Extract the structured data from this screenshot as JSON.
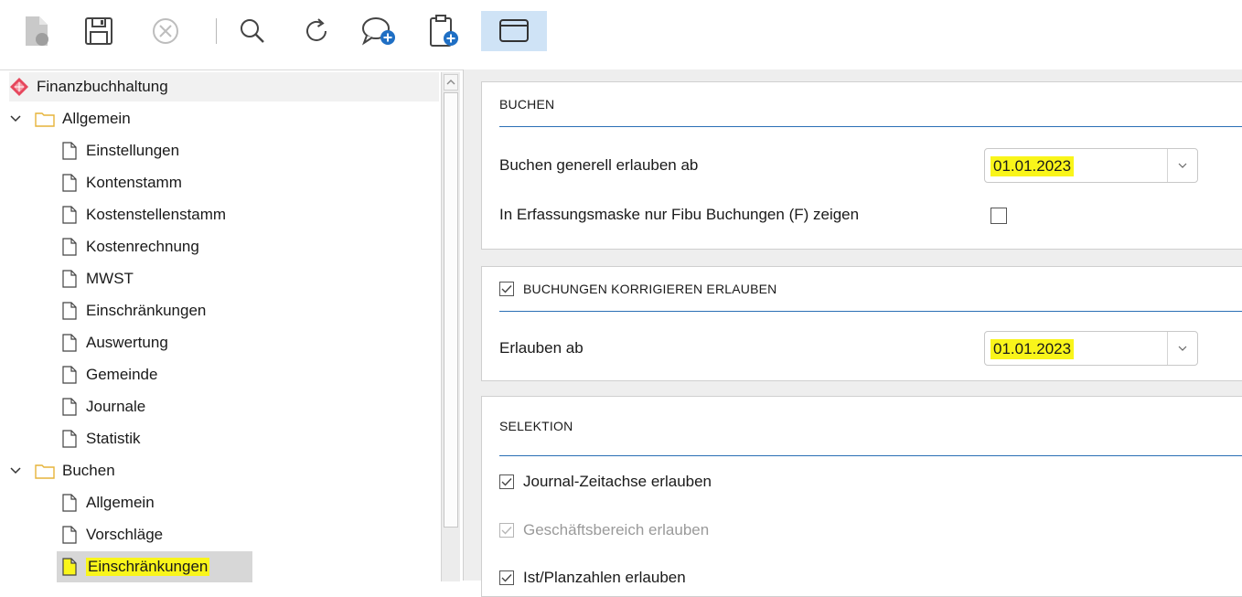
{
  "toolbar": {
    "icons": [
      "new-document-icon",
      "save-icon",
      "cancel-icon",
      "search-icon",
      "refresh-icon",
      "add-comment-icon",
      "add-clipboard-icon",
      "window-icon"
    ],
    "active_icon": "window-icon",
    "accent": "#2a6fb5"
  },
  "tree": {
    "root_label": "Finanzbuchhaltung",
    "folders": [
      {
        "label": "Allgemein",
        "items": [
          "Einstellungen",
          "Kontenstamm",
          "Kostenstellenstamm",
          "Kostenrechnung",
          "MWST",
          "Einschränkungen",
          "Auswertung",
          "Gemeinde",
          "Journale",
          "Statistik"
        ]
      },
      {
        "label": "Buchen",
        "items": [
          "Allgemein",
          "Vorschläge",
          "Einschränkungen"
        ]
      }
    ],
    "selected_item": "Einschränkungen",
    "highlight_color": "#f9f51a"
  },
  "sections": {
    "buchen": {
      "title": "BUCHEN",
      "row1_label": "Buchen generell erlauben ab",
      "row1_value": "01.01.2023",
      "row2_label": "In Erfassungsmaske nur Fibu Buchungen (F) zeigen",
      "row2_checked": false
    },
    "korrigieren": {
      "title": "BUCHUNGEN KORRIGIEREN ERLAUBEN",
      "title_checked": true,
      "row1_label": "Erlauben ab",
      "row1_value": "01.01.2023"
    },
    "selektion": {
      "title": "SELEKTION",
      "opt1": "Journal-Zeitachse erlauben",
      "opt2": "Geschäftsbereich erlauben",
      "opt3": "Ist/Planzahlen erlauben"
    }
  }
}
